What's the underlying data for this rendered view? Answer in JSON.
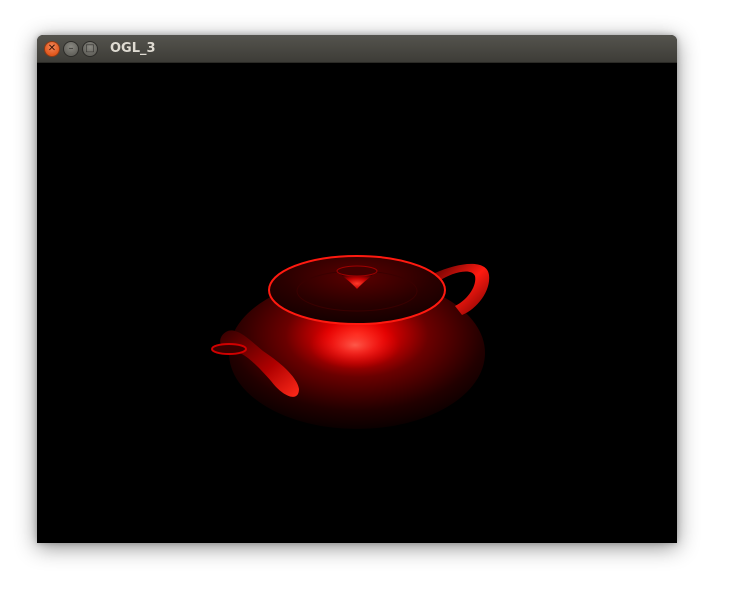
{
  "window": {
    "title": "OGL_3",
    "controls": {
      "close_icon": "close-icon",
      "minimize_icon": "minimize-icon",
      "maximize_icon": "maximize-icon"
    }
  },
  "scene": {
    "background_color": "#000000",
    "object": "teapot",
    "object_color": "#ff0000"
  }
}
